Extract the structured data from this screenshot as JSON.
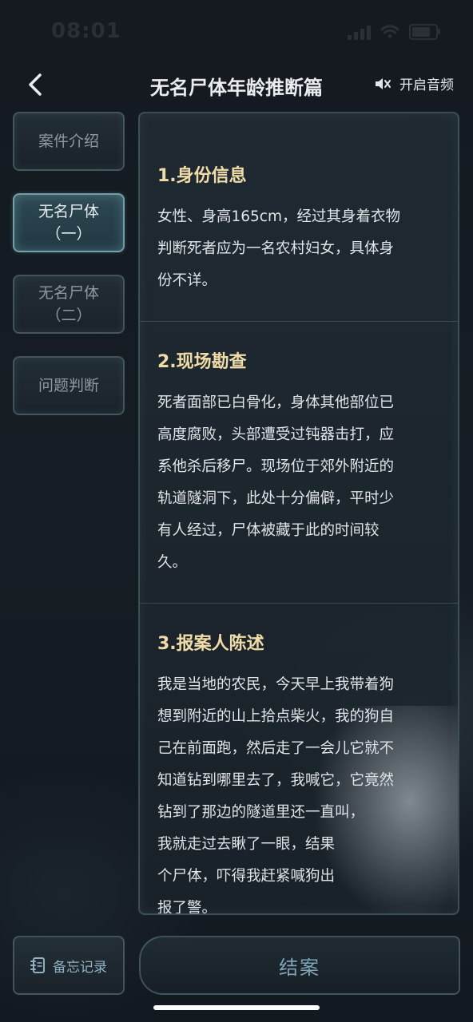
{
  "status_bar": {
    "time": "08:01"
  },
  "header": {
    "back_icon": "chevron-left-icon",
    "title": "无名尸体年龄推断篇",
    "audio_icon": "speaker-muted-icon",
    "audio_label": "开启音频"
  },
  "sidebar": {
    "items": [
      {
        "line1": "案件介绍",
        "line2": "",
        "active": false
      },
      {
        "line1": "无名尸体",
        "line2": "（一）",
        "active": true
      },
      {
        "line1": "无名尸体",
        "line2": "（二）",
        "active": false
      },
      {
        "line1": "问题判断",
        "line2": "",
        "active": false
      }
    ]
  },
  "content": {
    "sections": [
      {
        "heading": "1.身份信息",
        "lines": [
          "女性、身高165cm，经过其身着衣物",
          "判断死者应为一名农村妇女，具体身",
          "份不详。"
        ]
      },
      {
        "heading": "2.现场勘查",
        "lines": [
          "死者面部已白骨化，身体其他部位已",
          "高度腐败，头部遭受过钝器击打，应",
          "系他杀后移尸。现场位于郊外附近的",
          "轨道隧洞下，此处十分偏僻，平时少",
          "有人经过，尸体被藏于此的时间较",
          "久。"
        ]
      },
      {
        "heading": "3.报案人陈述",
        "lines": [
          "我是当地的农民，今天早上我带着狗",
          "想到附近的山上拾点柴火，我的狗自",
          "己在前面跑，然后走了一会儿它就不",
          "知道钻到哪里去了，我喊它，它竟然",
          "钻到了那边的隧道里还一直叫，",
          "我就走过去瞅了一眼，结果",
          "个尸体，吓得我赶紧喊狗出",
          "报了警。"
        ]
      }
    ]
  },
  "bottom": {
    "memo_icon": "notebook-icon",
    "memo_label": "备忘记录",
    "close_case_label": "结案"
  }
}
